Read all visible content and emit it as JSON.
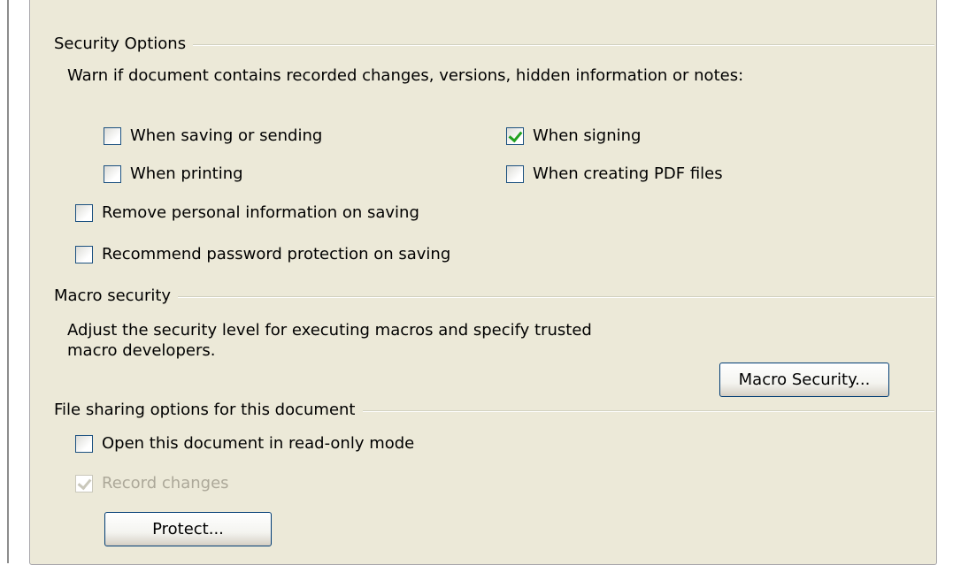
{
  "security_options": {
    "title": "Security Options",
    "warn_text": "Warn if document contains recorded changes, versions, hidden information or notes:",
    "when_saving": {
      "label": "When saving or sending",
      "checked": false
    },
    "when_signing": {
      "label": "When signing",
      "checked": true
    },
    "when_printing": {
      "label": "When printing",
      "checked": false
    },
    "when_creating_pdf": {
      "label": "When creating PDF files",
      "checked": false
    },
    "remove_personal": {
      "label": "Remove personal information on saving",
      "checked": false
    },
    "recommend_password": {
      "label": "Recommend password protection on saving",
      "checked": false
    }
  },
  "macro_security": {
    "title": "Macro security",
    "description_line1": "Adjust the security level for executing macros and specify trusted",
    "description_line2": "macro developers.",
    "button_label": "Macro Security..."
  },
  "file_sharing": {
    "title": "File sharing options for this document",
    "read_only": {
      "label": "Open this document in read-only mode",
      "checked": false
    },
    "record_changes": {
      "label": "Record changes",
      "checked": true,
      "disabled": true
    },
    "protect_button_label": "Protect..."
  },
  "colors": {
    "panel_bg": "#ece9d8",
    "checkbox_border": "#1c5180",
    "check_mark": "#21a121",
    "disabled_text": "#aca899",
    "button_border": "#003c74"
  }
}
